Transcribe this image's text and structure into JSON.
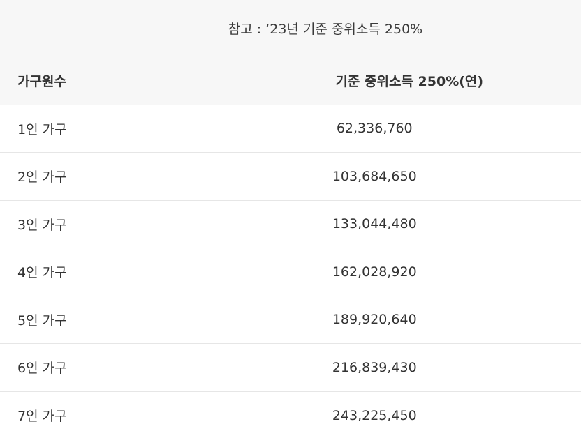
{
  "caption": "참고 : ‘23년 기준 중위소득 250%",
  "table": {
    "headers": [
      "가구원수",
      "기준 중위소득 250%(연)"
    ],
    "rows": [
      {
        "household": "1인 가구",
        "amount": "62,336,760"
      },
      {
        "household": "2인 가구",
        "amount": "103,684,650"
      },
      {
        "household": "3인 가구",
        "amount": "133,044,480"
      },
      {
        "household": "4인 가구",
        "amount": "162,028,920"
      },
      {
        "household": "5인 가구",
        "amount": "189,920,640"
      },
      {
        "household": "6인 가구",
        "amount": "216,839,430"
      },
      {
        "household": "7인 가구",
        "amount": "243,225,450"
      }
    ]
  },
  "colors": {
    "header_bg": "#f7f7f7",
    "border": "#e6e6e6",
    "text": "#333333"
  }
}
